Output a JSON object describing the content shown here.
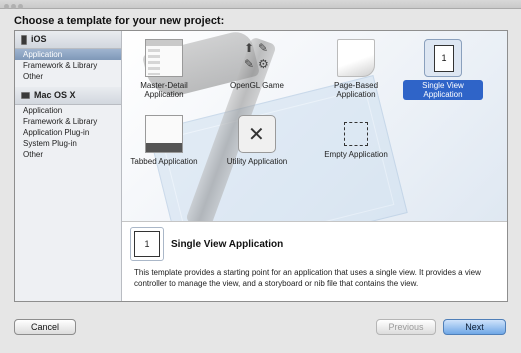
{
  "header": {
    "title": "Choose a template for your new project:"
  },
  "sidebar": {
    "sections": [
      {
        "title": "iOS",
        "items": [
          "Application",
          "Framework & Library",
          "Other"
        ],
        "selected": "Application"
      },
      {
        "title": "Mac OS X",
        "items": [
          "Application",
          "Framework & Library",
          "Application Plug-in",
          "System Plug-in",
          "Other"
        ]
      }
    ]
  },
  "templates": [
    {
      "label": "Master-Detail Application",
      "icon": "master-detail-icon"
    },
    {
      "label": "OpenGL Game",
      "icon": "opengl-game-icon"
    },
    {
      "label": "Page-Based Application",
      "icon": "page-based-icon"
    },
    {
      "label": "Single View Application",
      "icon": "single-view-icon",
      "selected": true,
      "glyph": "1"
    },
    {
      "label": "Tabbed Application",
      "icon": "tabbed-icon"
    },
    {
      "label": "Utility Application",
      "icon": "utility-icon"
    },
    {
      "label": "Empty Application",
      "icon": "empty-icon"
    }
  ],
  "detail": {
    "title": "Single View Application",
    "glyph": "1",
    "description": "This template provides a starting point for an application that uses a single view. It provides a view controller to manage the view, and a storyboard or nib file that contains the view."
  },
  "buttons": {
    "cancel": "Cancel",
    "previous": "Previous",
    "next": "Next"
  },
  "colors": {
    "selection": "#2f64c8",
    "sidebar_selection": "#8aa2c2",
    "next_button": "#6fa7e6"
  }
}
